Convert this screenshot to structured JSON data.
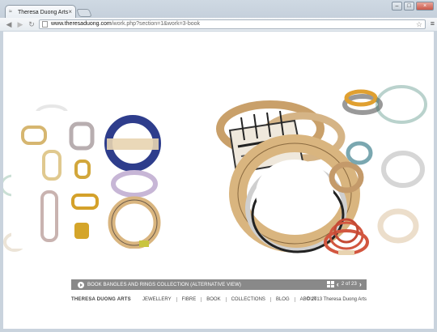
{
  "browser": {
    "tab_title": "Theresa Duong Arts",
    "tab_close": "×",
    "url_host": "www.theresaduong.com",
    "url_path": "/work.php?section=1&work=3-book",
    "window_buttons": [
      "–",
      "□",
      "×"
    ]
  },
  "caption": {
    "title": "BOOK BANGLES AND RINGS COLLECTION (ALTERNATIVE VIEW)",
    "pager": "2 of 23"
  },
  "footer": {
    "brand": "THERESA DUONG ARTS",
    "links": [
      "JEWELLERY",
      "FIBRE",
      "BOOK",
      "COLLECTIONS",
      "BLOG",
      "ABOUT"
    ],
    "copyright": "© 2013 Theresa Duong Arts"
  },
  "icons": [
    "back-icon",
    "forward-icon",
    "reload-icon",
    "page-icon",
    "star-icon",
    "menu-icon",
    "play-icon",
    "grid-icon",
    "prev-icon",
    "next-icon"
  ],
  "colors": {
    "captionbar": "#898989",
    "wood": "#d9b57f",
    "cobalt": "#2f3f8f",
    "coral": "#d2563f"
  }
}
